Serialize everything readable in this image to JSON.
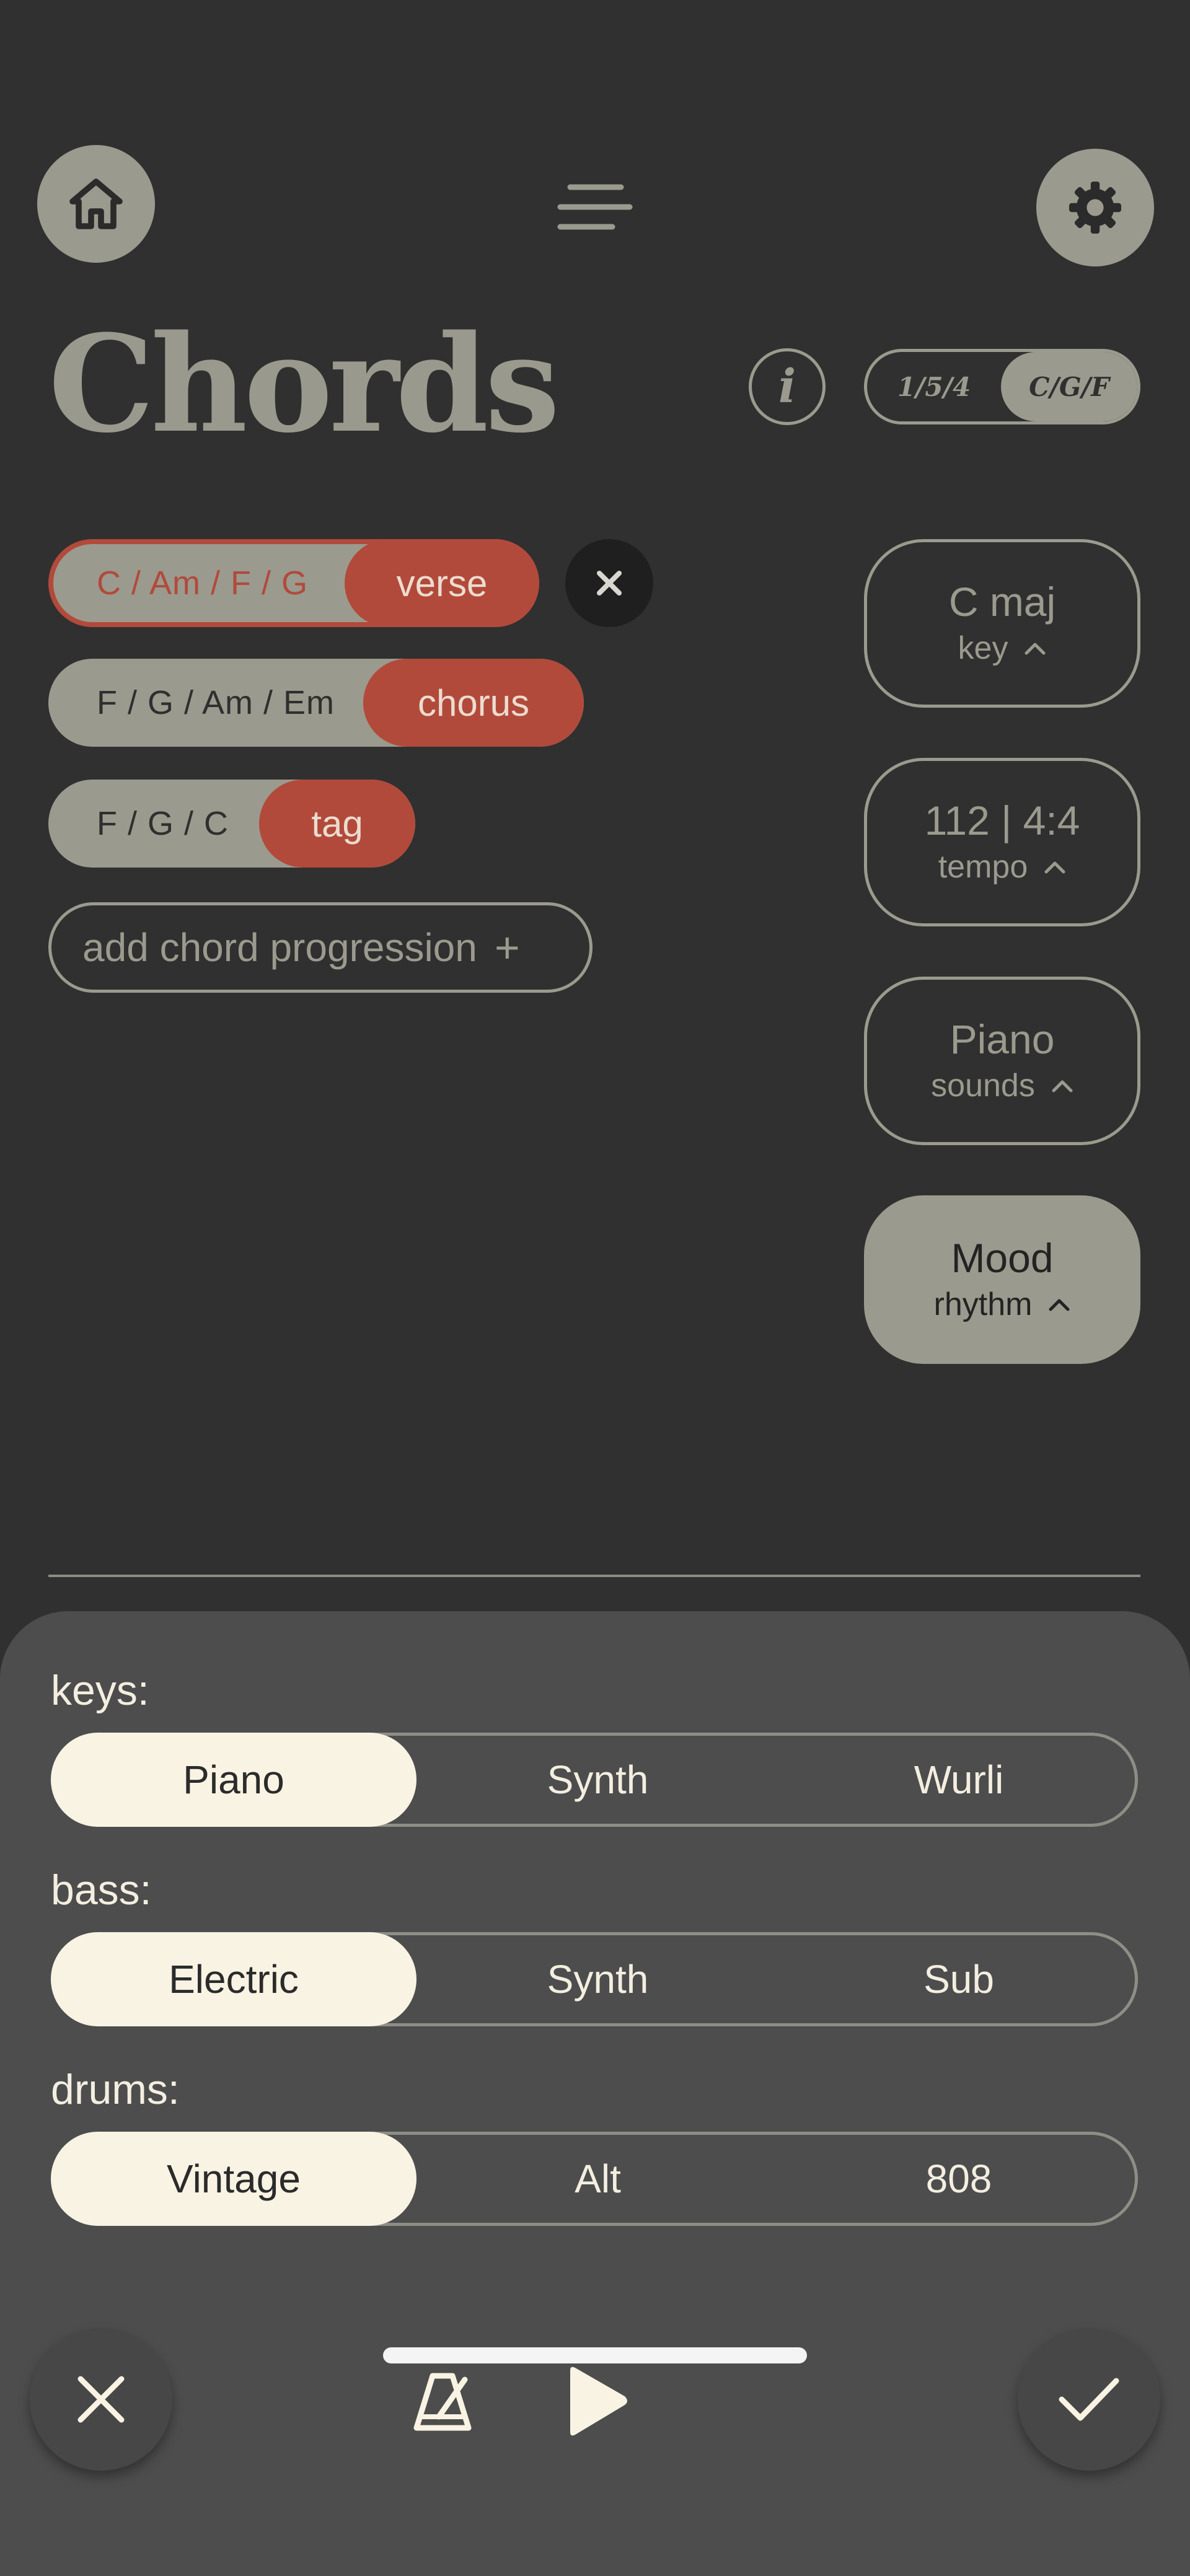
{
  "header": {
    "title": "Chords",
    "home_icon": "home-icon",
    "menu_icon": "menu-icon",
    "settings_icon": "gear-icon",
    "info_label": "i",
    "notation_toggle": {
      "left_label": "1/5/4",
      "right_label": "C/G/F",
      "selected": "C/G/F"
    }
  },
  "progressions": [
    {
      "chords": "C / Am / F / G",
      "section": "verse",
      "active": true
    },
    {
      "chords": "F / G / Am / Em",
      "section": "chorus",
      "active": false
    },
    {
      "chords": "F / G / C",
      "section": "tag",
      "active": false
    }
  ],
  "add_progression_label": "add chord progression",
  "add_progression_icon": "+",
  "cards": {
    "key": {
      "value": "C maj",
      "label": "key"
    },
    "tempo": {
      "value": "112 | 4:4",
      "label": "tempo"
    },
    "sounds": {
      "value": "Piano",
      "label": "sounds"
    },
    "rhythm": {
      "value": "Mood",
      "label": "rhythm"
    }
  },
  "sheet": {
    "keys": {
      "label": "keys:",
      "options": [
        "Piano",
        "Synth",
        "Wurli"
      ],
      "selected": "Piano"
    },
    "bass": {
      "label": "bass:",
      "options": [
        "Electric",
        "Synth",
        "Sub"
      ],
      "selected": "Electric"
    },
    "drums": {
      "label": "drums:",
      "options": [
        "Vintage",
        "Alt",
        "808"
      ],
      "selected": "Vintage"
    }
  },
  "footer": {
    "cancel_icon": "close-icon",
    "metronome_icon": "metronome-icon",
    "play_icon": "play-icon",
    "confirm_icon": "check-icon"
  },
  "colors": {
    "background": "#303030",
    "accent_red": "#b24a3b",
    "muted": "#9b9a8e",
    "sheet": "#4d4d4d",
    "selected": "#f8f3e3"
  }
}
